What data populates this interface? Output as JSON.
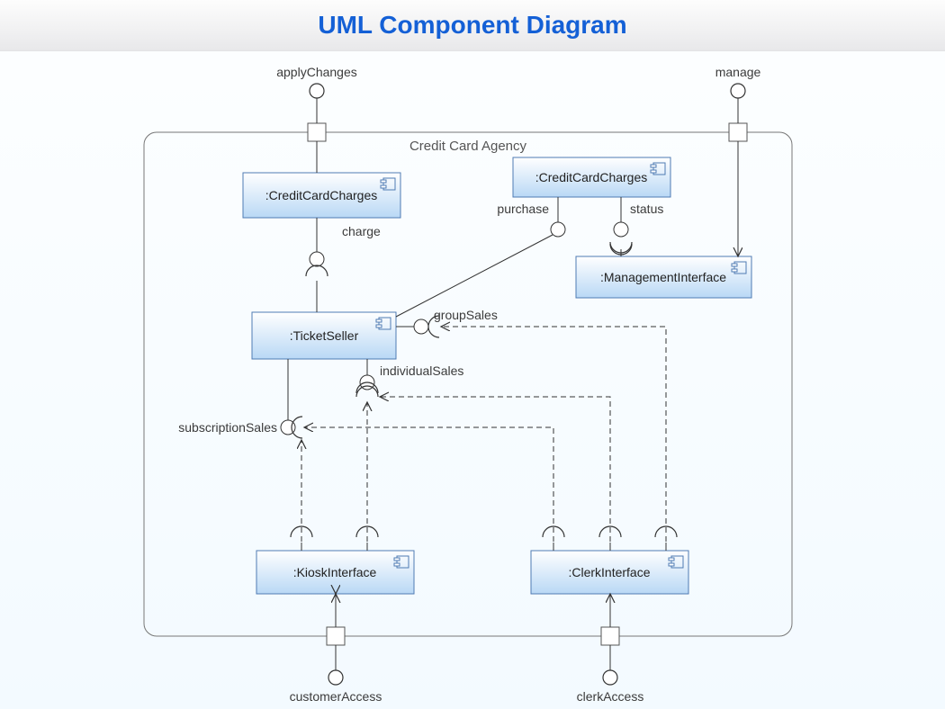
{
  "header": {
    "title": "UML Component Diagram"
  },
  "container": {
    "name": "Credit Card Agency"
  },
  "components": {
    "cc1": ":CreditCardCharges",
    "cc2": ":CreditCardCharges",
    "mgmt": ":ManagementInterface",
    "seller": ":TicketSeller",
    "kiosk": ":KioskInterface",
    "clerk": ":ClerkInterface"
  },
  "interfaces": {
    "applyChanges": "applyChanges",
    "manage": "manage",
    "charge": "charge",
    "purchase": "purchase",
    "status": "status",
    "groupSales": "groupSales",
    "individualSales": "individualSales",
    "subscriptionSales": "subscriptionSales",
    "customerAccess": "customerAccess",
    "clerkAccess": "clerkAccess"
  }
}
